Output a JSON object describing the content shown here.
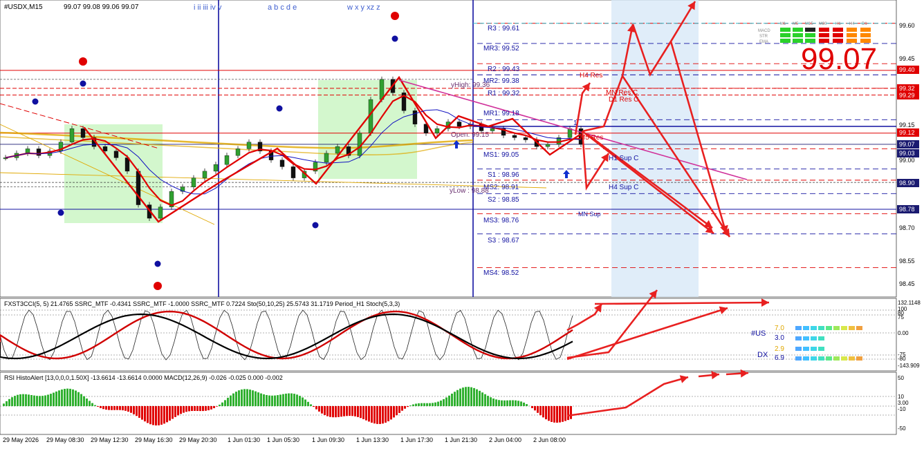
{
  "window": {
    "symbol_title": "#USDX,M15",
    "ohlc_text": "99.07 99.08 99.06 99.07",
    "big_price": "99.07"
  },
  "wave_labels": [
    "i ii iii iv v",
    "a b c d e",
    "w x y xz z"
  ],
  "colors": {
    "background": "#ffffff",
    "bull_wave": "#e00000",
    "pink_trend": "#d0309a",
    "blue_line": "#1010a0",
    "green_box": "#c8f5c0",
    "session_box": "#d8e8f8",
    "gold_line": "#e0a800",
    "macd_up": "#30b030",
    "macd_down": "#e00000"
  },
  "chart_data": [
    {
      "type": "line",
      "name": "main_price",
      "ylim": [
        98.38,
        99.68
      ],
      "y_ticks": [
        {
          "value": 99.6,
          "label": "99.60"
        },
        {
          "value": 99.45,
          "label": "99.45"
        },
        {
          "value": 99.3,
          "label": "99.30"
        },
        {
          "value": 99.15,
          "label": "99.15"
        },
        {
          "value": 99.0,
          "label": "99.00"
        },
        {
          "value": 98.85,
          "label": "98.85"
        },
        {
          "value": 98.7,
          "label": "98.70"
        },
        {
          "value": 98.55,
          "label": "98.55"
        },
        {
          "value": 98.45,
          "label": "98.45"
        }
      ],
      "price_badges": [
        {
          "value": 99.4,
          "label": "99.40",
          "color": "#e00000"
        },
        {
          "value": 99.32,
          "label": "99.32",
          "color": "#e00000"
        },
        {
          "value": 99.29,
          "label": "99.29",
          "color": "#e00000"
        },
        {
          "value": 99.12,
          "label": "99.12",
          "color": "#e00000"
        },
        {
          "value": 99.07,
          "label": "99.07",
          "color": "#1a1a70"
        },
        {
          "value": 99.03,
          "label": "99.03",
          "color": "#1a1a70"
        },
        {
          "value": 98.9,
          "label": "98.90",
          "color": "#1a1a70"
        },
        {
          "value": 98.78,
          "label": "98.78",
          "color": "#1a1a70"
        }
      ],
      "pivots": [
        {
          "label": "R3 : 99.61",
          "value": 99.61
        },
        {
          "label": "MR3: 99.52",
          "value": 99.52
        },
        {
          "label": "R2 : 99.43",
          "value": 99.43
        },
        {
          "label": "MR2: 99.38",
          "value": 99.38
        },
        {
          "label": "R1 : 99.32",
          "value": 99.32
        },
        {
          "label": "MR1: 99.18",
          "value": 99.18
        },
        {
          "label": "MS1: 99.05",
          "value": 99.05
        },
        {
          "label": "S1 : 98.96",
          "value": 98.96
        },
        {
          "label": "MS2: 98.91",
          "value": 98.91
        },
        {
          "label": "S2 : 98.85",
          "value": 98.85
        },
        {
          "label": "MS3: 98.76",
          "value": 98.76
        },
        {
          "label": "S3 : 98.67",
          "value": 98.67
        },
        {
          "label": "MS4: 98.52",
          "value": 98.52
        }
      ],
      "annotations": [
        "yHigh: 99.36",
        "yLow : 98.88",
        "Open: 99.15",
        "H4 Res",
        "H4 Sup C",
        "H1 Sup C",
        "M5 Res",
        "D1 Res C",
        "MN Res C",
        "MN Sup",
        "1"
      ],
      "close_series": [
        99.01,
        99.03,
        99.05,
        99.02,
        99.04,
        99.08,
        99.14,
        99.1,
        99.06,
        99.04,
        99.01,
        98.95,
        98.8,
        98.74,
        98.79,
        98.86,
        98.88,
        98.92,
        98.95,
        98.98,
        99.02,
        99.05,
        99.08,
        99.04,
        99.0,
        98.97,
        98.92,
        98.95,
        98.99,
        99.03,
        99.06,
        99.02,
        99.12,
        99.27,
        99.36,
        99.3,
        99.22,
        99.16,
        99.12,
        99.14,
        99.17,
        99.15,
        99.16,
        99.13,
        99.14,
        99.11,
        99.1,
        99.09,
        99.06,
        99.07,
        99.1,
        99.14,
        99.07
      ]
    },
    {
      "type": "line",
      "name": "cci_stoch_panel",
      "title": "FXST3CCI(5, 5) 21.4765  SSRC_MTF -0.4341  SSRC_MTF -1.0000  SSRC_MTF 0.7224  Sto(50,10,25) 25.5743 31.1719  Period_H1 Stoch(5,3,3)",
      "right_labels": [
        "132.1148",
        "100",
        "80",
        "75",
        "0.00",
        "-75",
        "-80",
        "-143.909"
      ],
      "dashboard": [
        {
          "label": "#US",
          "values": [
            "7.0",
            "3.0"
          ]
        },
        {
          "label": "DX",
          "values": [
            "2.9",
            "6.9"
          ]
        }
      ]
    },
    {
      "type": "bar",
      "name": "rsi_histo_macd",
      "title": "RSI HistoAlert [13,0,0,0,1.50X] -13.6614 -13.6614 0.0000  MACD(12,26,9) -0.026 -0.025 0.000 -0.002",
      "y_ticks": [
        {
          "value": 50,
          "label": "50"
        },
        {
          "value": 10,
          "label": "10"
        },
        {
          "value": 3,
          "label": "3.00"
        },
        {
          "value": 0,
          "label": "0.00"
        },
        {
          "value": -10,
          "label": "-10"
        },
        {
          "value": -50,
          "label": "-50"
        }
      ],
      "ylim": [
        -60,
        60
      ]
    }
  ],
  "x_axis": {
    "labels": [
      "29 May 2026",
      "29 May 08:30",
      "29 May 12:30",
      "29 May 16:30",
      "29 May 20:30",
      "1 Jun 01:30",
      "1 Jun 05:30",
      "1 Jun 09:30",
      "1 Jun 13:30",
      "1 Jun 17:30",
      "1 Jun 21:30",
      "2 Jun 04:00",
      "2 Jun 08:00"
    ]
  },
  "mtf_table": {
    "headers": [
      "M1",
      "M5",
      "M15",
      "M30",
      "H1",
      "H4",
      "D1"
    ],
    "rows": [
      "MACD",
      "STR",
      "EMA"
    ]
  }
}
